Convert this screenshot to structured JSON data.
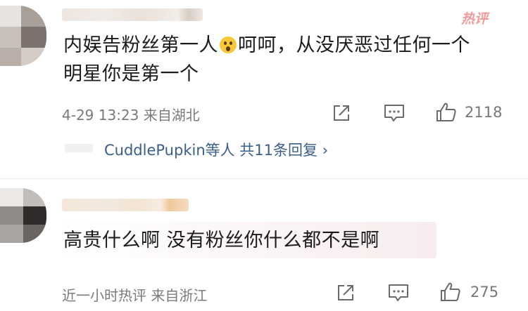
{
  "comment1": {
    "hot_label": "热评",
    "text_line1_a": "内娱告粉丝第一人",
    "emoji": "astonished-face",
    "text_line1_b": "呵呵，从没厌恶过任何一个",
    "text_line2": "明星你是第一个",
    "meta": "4-29 13:23  来自湖北",
    "like_count": "2118",
    "replies_text": "CuddlePupkin等人  共11条回复 ›"
  },
  "comment2": {
    "text": "高贵什么啊 没有粉丝你什么都不是啊",
    "meta": "近一小时热评  来自浙江",
    "like_count": "275"
  },
  "icons": {
    "share": "share-icon",
    "comment": "comment-icon",
    "like": "thumbs-up-icon"
  },
  "colors": {
    "hot_tag": "#f29a9a",
    "reply_link": "#3a5e8c",
    "meta_text": "#7a7a7a"
  }
}
